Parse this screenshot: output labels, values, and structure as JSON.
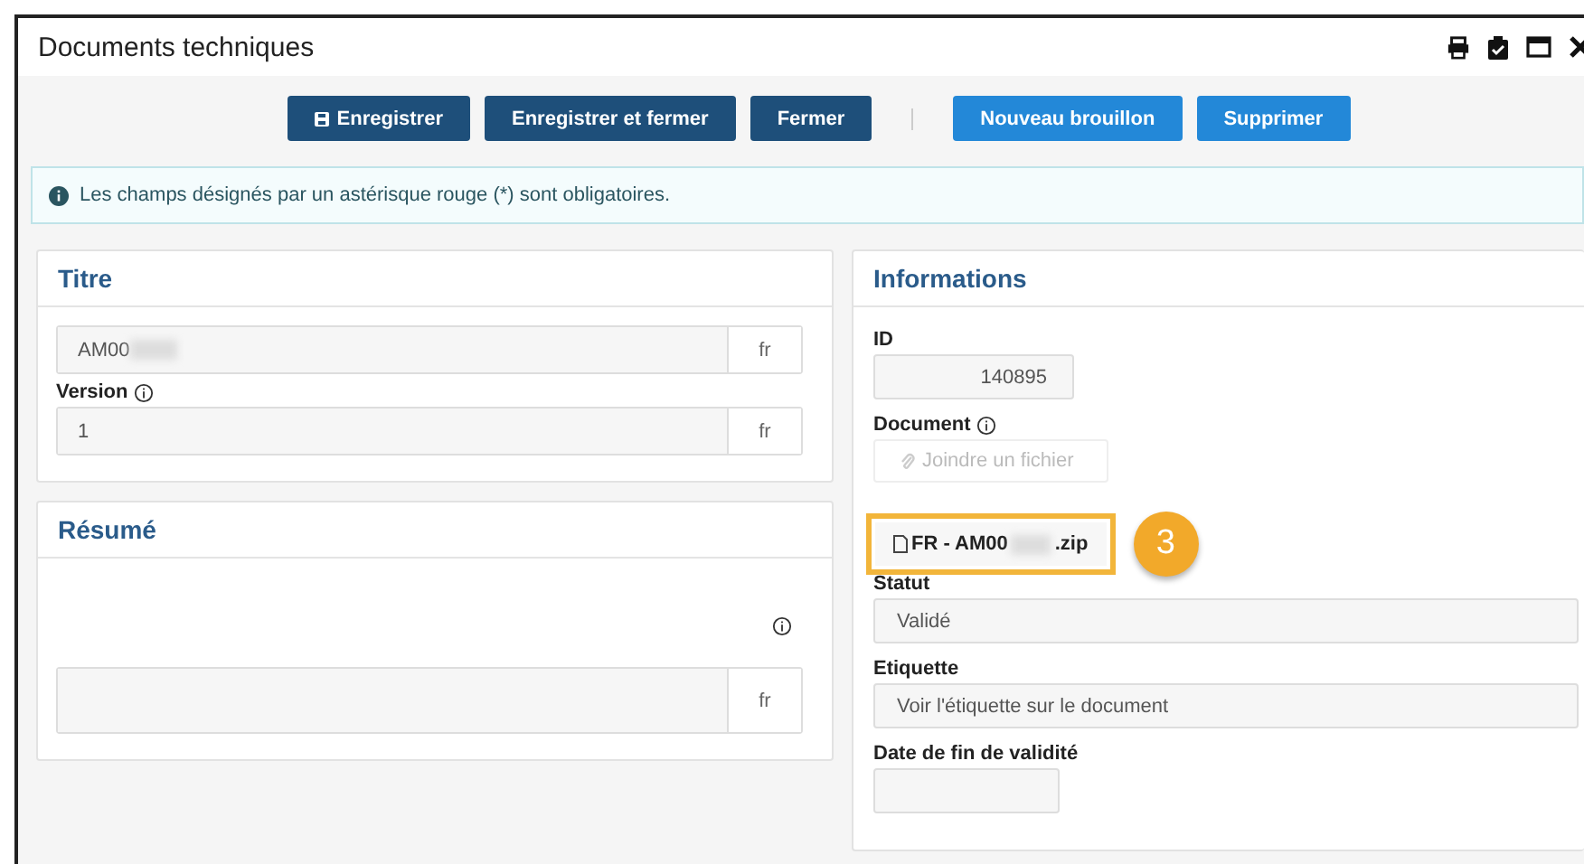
{
  "window": {
    "title": "Documents techniques"
  },
  "toolbar": [
    {
      "label": "Enregistrer",
      "kind": "dark"
    },
    {
      "label": "Enregistrer et fermer",
      "kind": "dark"
    },
    {
      "label": "Fermer",
      "kind": "dark"
    },
    {
      "label": "Nouveau brouillon",
      "kind": "light"
    },
    {
      "label": "Supprimer",
      "kind": "light"
    }
  ],
  "alert": {
    "text": "Les champs désignés par un astérisque rouge (*) sont obligatoires."
  },
  "titre_panel": {
    "heading": "Titre",
    "title_value": "AM00",
    "title_redacted": true,
    "title_lang": "fr",
    "version_label": "Version",
    "version_value": "1",
    "version_lang": "fr"
  },
  "resume_panel": {
    "heading": "Résumé",
    "lang": "fr"
  },
  "info_panel": {
    "heading": "Informations",
    "id_label": "ID",
    "id_value": "140895",
    "document_label": "Document",
    "attach_placeholder": "Joindre un fichier",
    "file": {
      "name_start": "FR - AM00",
      "redacted": true,
      "name_end": ".zip"
    },
    "callout": "3",
    "statut_label": "Statut",
    "statut_value": "Validé",
    "etiquette_label": "Etiquette",
    "etiquette_value": "Voir l'étiquette sur le document",
    "date_label": "Date de fin de validité"
  }
}
